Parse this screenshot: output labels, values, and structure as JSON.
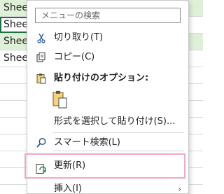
{
  "sheet": {
    "rows": [
      {
        "label": "Shee",
        "style": "alt"
      },
      {
        "label": "Shee",
        "style": "selected"
      },
      {
        "label": "Shee",
        "style": "alt"
      },
      {
        "label": "Shee",
        "style": "plain"
      }
    ]
  },
  "menu": {
    "search_placeholder": "メニューの検索",
    "cut_label": "切り取り(T)",
    "copy_label": "コピー(C)",
    "paste_options_label": "貼り付けのオプション:",
    "paste_special_label": "形式を選択して貼り付け(S)...",
    "smart_lookup_label": "スマート検索(L)",
    "refresh_label": "更新(R)",
    "insert_label": "挿入(I)",
    "submenu_arrow": "›"
  },
  "colors": {
    "selection_border": "#1f7244",
    "row_alt": "#dff0d8",
    "highlight_border": "#f0a8c8"
  },
  "icons": {
    "cut": "scissors-icon",
    "copy": "copy-icon",
    "paste_options": "clipboard-icon",
    "paste_big": "clipboard-paste-icon",
    "smart_lookup": "magnifier-icon",
    "refresh": "refresh-icon"
  }
}
